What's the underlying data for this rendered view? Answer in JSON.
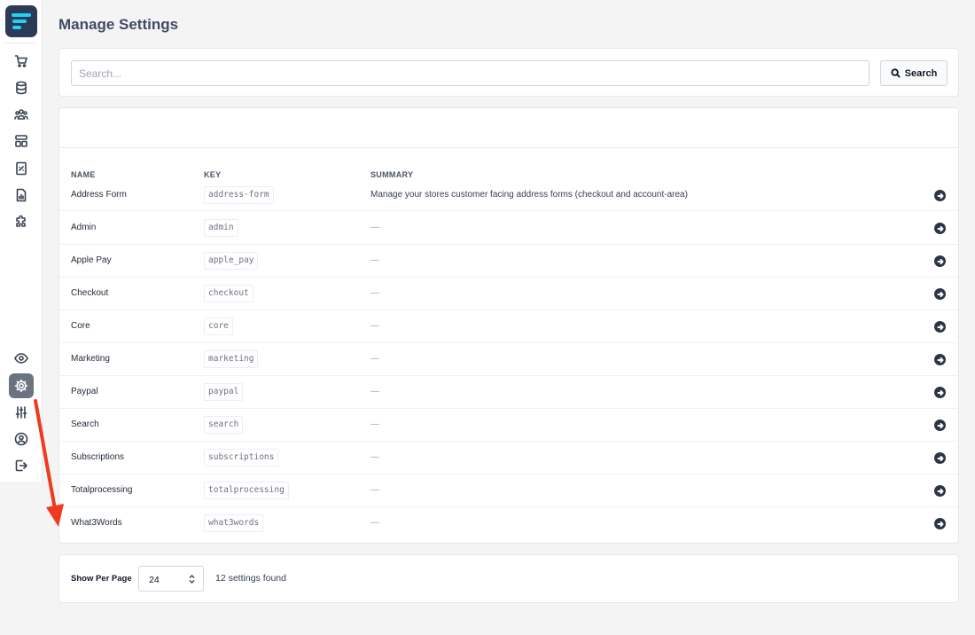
{
  "page": {
    "title": "Manage Settings"
  },
  "sidebar": {
    "top_items": [
      {
        "icon": "cart-icon"
      },
      {
        "icon": "database-icon"
      },
      {
        "icon": "users-icon"
      },
      {
        "icon": "layout-icon"
      },
      {
        "icon": "receipt-icon"
      },
      {
        "icon": "report-icon"
      },
      {
        "icon": "puzzle-icon"
      }
    ],
    "bottom_items": [
      {
        "icon": "eye-icon"
      },
      {
        "icon": "gear-icon",
        "active": true
      },
      {
        "icon": "sliders-icon"
      },
      {
        "icon": "user-circle-icon"
      },
      {
        "icon": "logout-icon"
      }
    ]
  },
  "search": {
    "placeholder": "Search...",
    "button_label": "Search"
  },
  "table": {
    "columns": [
      "NAME",
      "KEY",
      "SUMMARY"
    ],
    "rows": [
      {
        "name": "Address Form",
        "key": "address-form",
        "summary": "Manage your stores customer facing address forms (checkout and account-area)"
      },
      {
        "name": "Admin",
        "key": "admin",
        "summary": "—"
      },
      {
        "name": "Apple Pay",
        "key": "apple_pay",
        "summary": "—"
      },
      {
        "name": "Checkout",
        "key": "checkout",
        "summary": "—"
      },
      {
        "name": "Core",
        "key": "core",
        "summary": "—"
      },
      {
        "name": "Marketing",
        "key": "marketing",
        "summary": "—"
      },
      {
        "name": "Paypal",
        "key": "paypal",
        "summary": "—"
      },
      {
        "name": "Search",
        "key": "search",
        "summary": "—"
      },
      {
        "name": "Subscriptions",
        "key": "subscriptions",
        "summary": "—"
      },
      {
        "name": "Totalprocessing",
        "key": "totalprocessing",
        "summary": "—"
      },
      {
        "name": "What3Words",
        "key": "what3words",
        "summary": "—"
      }
    ]
  },
  "footer": {
    "per_page_label": "Show Per Page",
    "per_page_value": "24",
    "found_text": "12 settings found"
  },
  "colors": {
    "annotation_arrow": "#ee3b1c",
    "logo_bg": "#2d3a57",
    "logo_accent": "#22d3ee"
  }
}
